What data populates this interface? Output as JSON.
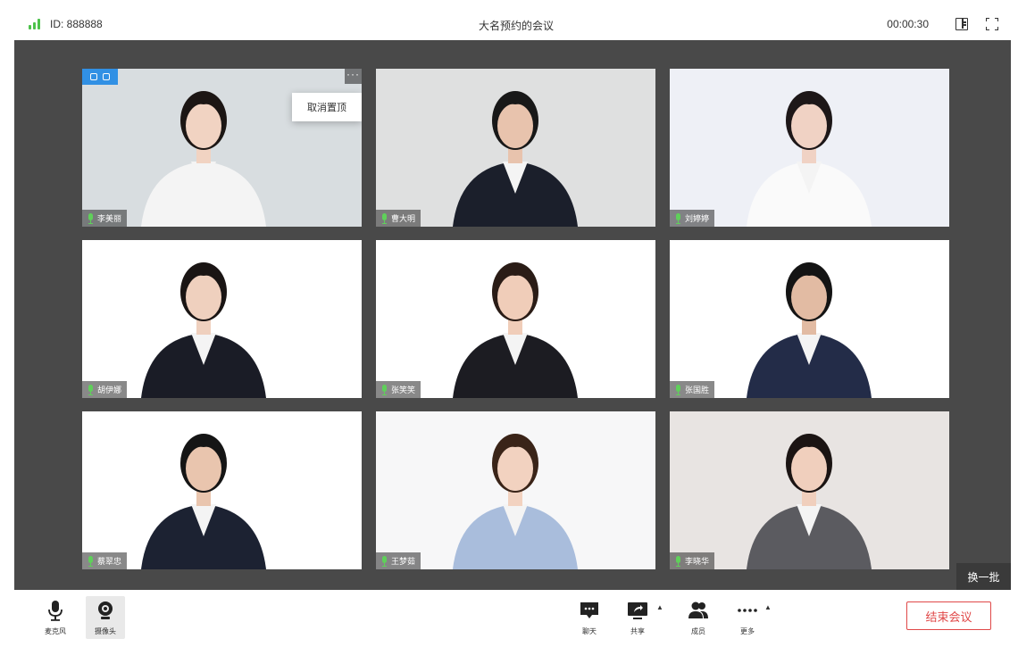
{
  "header": {
    "meeting_id": "ID: 888888",
    "title": "大名预约的会议",
    "timer": "00:00:30",
    "signal_color": "#4cc24a"
  },
  "participants": [
    {
      "name": "李美丽",
      "pinned": true,
      "bg": "#d8dde0",
      "skin": "#f1d3c2",
      "hair": "#1c1614",
      "outfit": "#f4f4f4"
    },
    {
      "name": "曹大明",
      "pinned": false,
      "bg": "#dfe0e0",
      "skin": "#e8c3ad",
      "hair": "#181818",
      "outfit": "#1b1f2b"
    },
    {
      "name": "刘婷婷",
      "pinned": false,
      "bg": "#eef0f6",
      "skin": "#f0d2c4",
      "hair": "#1d1718",
      "outfit": "#fafafa"
    },
    {
      "name": "胡伊娜",
      "pinned": false,
      "bg": "#ffffff",
      "skin": "#efd0be",
      "hair": "#1a1514",
      "outfit": "#1a1c26"
    },
    {
      "name": "张笑笑",
      "pinned": false,
      "bg": "#ffffff",
      "skin": "#f0cdb9",
      "hair": "#2a1c16",
      "outfit": "#1c1c22"
    },
    {
      "name": "张国胜",
      "pinned": false,
      "bg": "#ffffff",
      "skin": "#e2bba3",
      "hair": "#141414",
      "outfit": "#232c48"
    },
    {
      "name": "蔡翠忠",
      "pinned": false,
      "bg": "#ffffff",
      "skin": "#e9c5ae",
      "hair": "#151515",
      "outfit": "#1c2232"
    },
    {
      "name": "王梦茹",
      "pinned": false,
      "bg": "#f7f7f8",
      "skin": "#f2d2c0",
      "hair": "#3a2418",
      "outfit": "#a9bddc"
    },
    {
      "name": "李晓华",
      "pinned": false,
      "bg": "#e8e4e2",
      "skin": "#f0cfbd",
      "hair": "#1b1413",
      "outfit": "#5b5b60"
    }
  ],
  "pin_menu": {
    "unpin_label": "取消置顶"
  },
  "more_glyph": "···",
  "next_batch_label": "换一批",
  "toolbar": {
    "mic_label": "麦克风",
    "camera_label": "摄像头",
    "chat_label": "聊天",
    "share_label": "共享",
    "members_label": "成员",
    "more_label": "更多",
    "end_label": "结束会议",
    "end_color": "#e04848"
  }
}
